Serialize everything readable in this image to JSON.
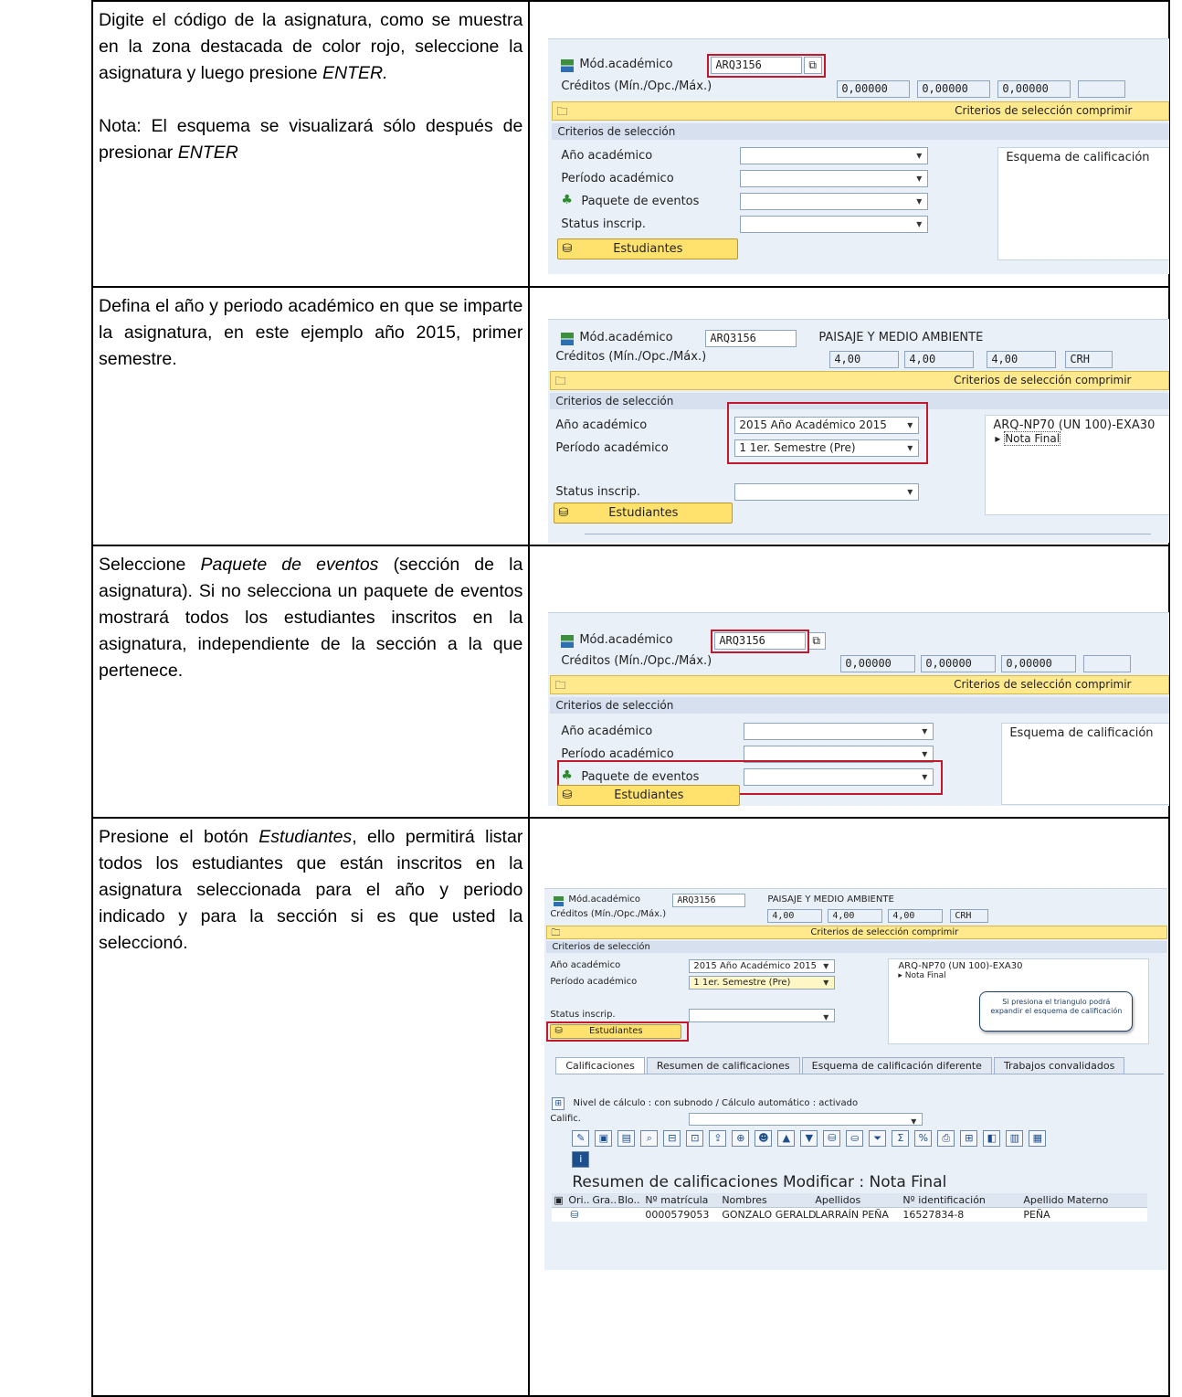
{
  "rows": [
    {
      "paragraphs": [
        [
          "Digite el código de la asignatura, como se muestra en la zona destacada de color rojo, seleccione la asignatura y luego presione ",
          {
            "em": "ENTER."
          }
        ],
        [
          "Nota: El esquema se visualizará sólo después de presionar ",
          {
            "em": "ENTER"
          }
        ]
      ]
    },
    {
      "paragraphs": [
        [
          "Defina el año y periodo académico en que se imparte la asignatura, en este ejemplo año 2015, primer semestre."
        ]
      ]
    },
    {
      "paragraphs": [
        [
          "Seleccione ",
          {
            "em": "Paquete de eventos"
          },
          " (sección de la asignatura). Si no selecciona un paquete de eventos mostrará todos los estudiantes inscritos en la asignatura, independiente de la sección a la que pertenece."
        ]
      ]
    },
    {
      "paragraphs": [
        [
          "Presione el botón ",
          {
            "em": "Estudiantes"
          },
          ", ello permitirá listar todos los estudiantes que están inscritos en la asignatura seleccionada para el año y periodo indicado y para la sección si es que usted la seleccionó."
        ]
      ]
    }
  ],
  "sap": {
    "mod_label": "Mód.académico",
    "mod_value": "ARQ3156",
    "course_name": "PAISAJE Y MEDIO AMBIENTE",
    "creditos_label": "Créditos (Mín./Opc./Máx.)",
    "credit_empty": [
      "0,00000",
      "0,00000",
      "0,00000"
    ],
    "credit_filled": [
      "4,00",
      "4,00",
      "4,00"
    ],
    "credit_unit": "CRH",
    "criterios_comprimir": "Criterios de selección comprimir",
    "criterios_label": "Criterios de selección",
    "anio_label": "Año académico",
    "periodo_label": "Período académico",
    "paquete_label": "Paquete de eventos",
    "status_label": "Status inscrip.",
    "estudiantes_button": "Estudiantes",
    "esquema_label": "Esquema de calificación",
    "anio_value": "2015 Año Académico 2015",
    "periodo_value": "1 1er. Semestre (Pre)",
    "schema_name": "ARQ-NP70 (UN 100)-EXA30",
    "nota_final": "Nota Final",
    "bubble_text": "Si presiona el triangulo podrá expandir el esquema de calificación",
    "tabs": [
      "Calificaciones",
      "Resumen de calificaciones",
      "Esquema de calificación diferente",
      "Trabajos convalidados"
    ],
    "nivel_text": "Nivel de cálculo : con subnodo / Cálculo automático : activado",
    "calific_label": "Calific.",
    "grid_title": "Resumen de calificaciones Modificar : Nota Final",
    "grid_headers": [
      "Ori..",
      "Gra..",
      "Blo..",
      "Nº matrícula",
      "Nombres",
      "Apellidos",
      "Nº identificación",
      "Apellido Materno"
    ],
    "grid_row": [
      "0000579053",
      "GONZALO GERALD",
      "LARRAÍN PEÑA",
      "16527834-8",
      "PEÑA"
    ]
  }
}
